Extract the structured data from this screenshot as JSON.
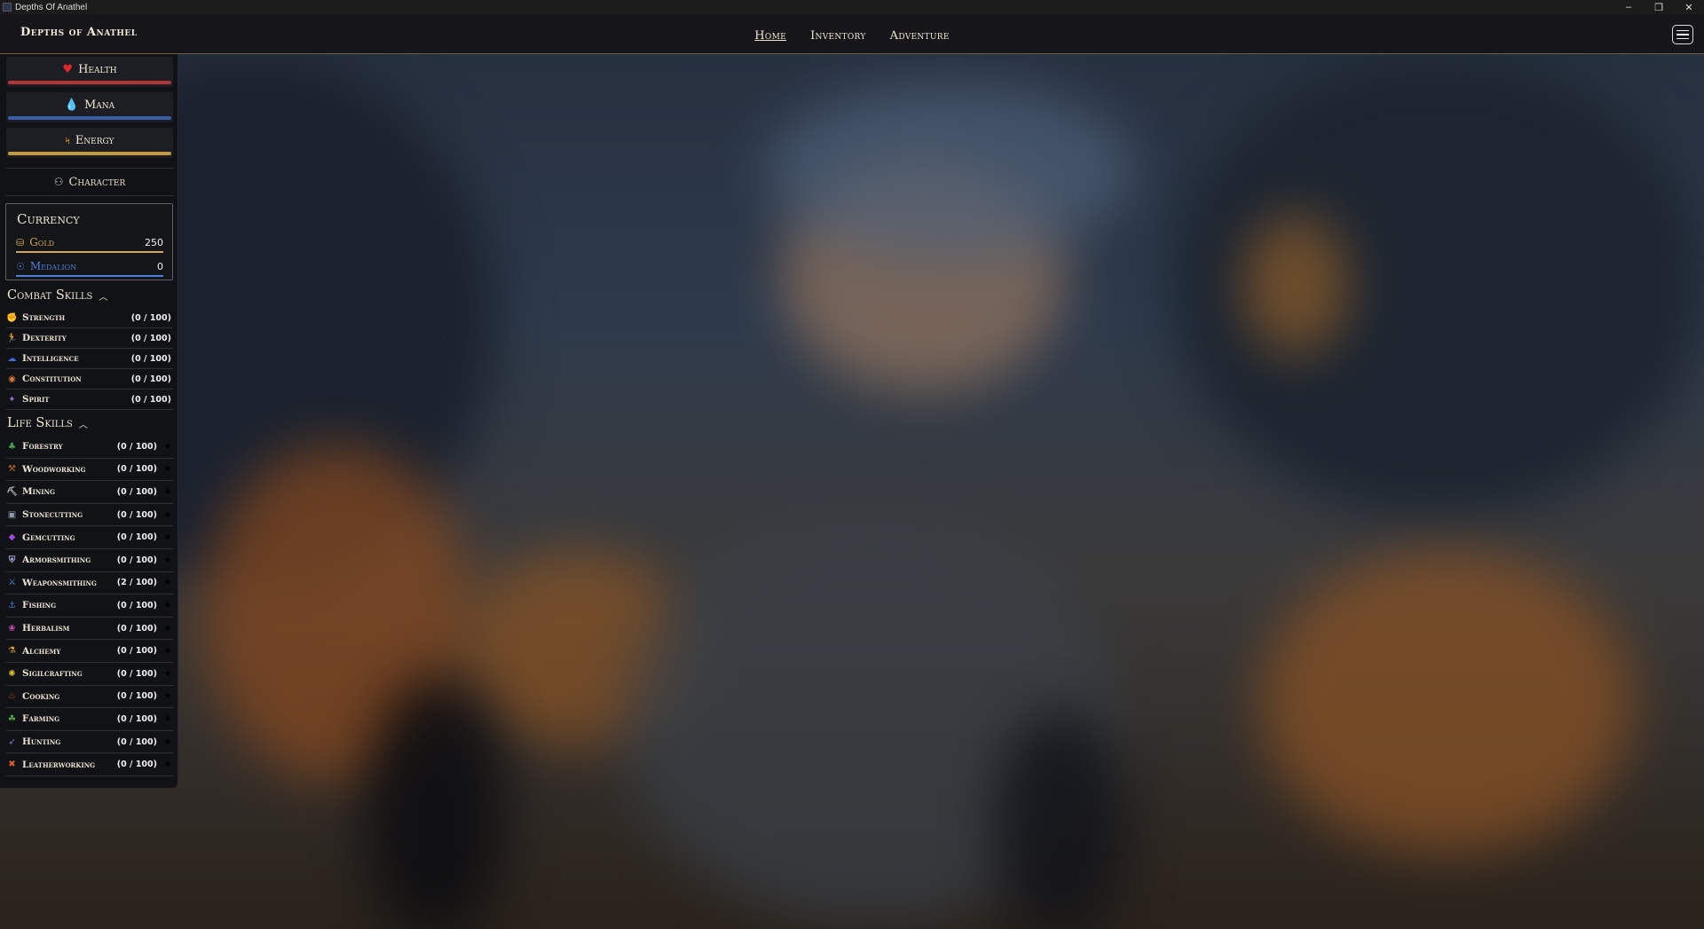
{
  "window": {
    "title": "Depths Of Anathel",
    "controls": [
      "–",
      "❐",
      "✕"
    ]
  },
  "nav": {
    "brand": "Depths of Anathel",
    "links": [
      {
        "label": "Home",
        "active": true
      },
      {
        "label": "Inventory",
        "active": false
      },
      {
        "label": "Adventure",
        "active": false
      }
    ],
    "menu_icon": "hamburger-icon"
  },
  "stats": {
    "health": {
      "label": "Health",
      "icon": "heart-icon",
      "color": "#c0393b"
    },
    "mana": {
      "label": "Mana",
      "icon": "droplet-icon",
      "color": "#3a5fb0"
    },
    "energy": {
      "label": "Energy",
      "icon": "lightning-icon",
      "color": "#c79a3a"
    }
  },
  "character": {
    "label": "Character",
    "icon": "people-icon"
  },
  "currency": {
    "title": "Currency",
    "gold": {
      "label": "Gold",
      "value": "250",
      "color": "#d4a84a"
    },
    "medalion": {
      "label": "Medalion",
      "value": "0",
      "color": "#4f7fd6"
    }
  },
  "combat_skills": {
    "title": "Combat Skills",
    "items": [
      {
        "name": "Strength",
        "value": "(0 / 100)",
        "icon": "fist-icon",
        "color": "#d2433c"
      },
      {
        "name": "Dexterity",
        "value": "(0 / 100)",
        "icon": "running-icon",
        "color": "#3fbf4a"
      },
      {
        "name": "Intelligence",
        "value": "(0 / 100)",
        "icon": "brain-icon",
        "color": "#3d6fd8"
      },
      {
        "name": "Constitution",
        "value": "(0 / 100)",
        "icon": "chest-icon",
        "color": "#d87a3a"
      },
      {
        "name": "Spirit",
        "value": "(0 / 100)",
        "icon": "spirit-icon",
        "color": "#9a6ad8"
      }
    ]
  },
  "life_skills": {
    "title": "Life Skills",
    "items": [
      {
        "name": "Forestry",
        "value": "(0 / 100)",
        "icon": "tree-icon",
        "color": "#3fa54a"
      },
      {
        "name": "Woodworking",
        "value": "(0 / 100)",
        "icon": "saw-icon",
        "color": "#c86a2a"
      },
      {
        "name": "Mining",
        "value": "(0 / 100)",
        "icon": "pickaxe-icon",
        "color": "#bdbdbd"
      },
      {
        "name": "Stonecutting",
        "value": "(0 / 100)",
        "icon": "stone-icon",
        "color": "#8e9bb0"
      },
      {
        "name": "Gemcutting",
        "value": "(0 / 100)",
        "icon": "gem-icon",
        "color": "#a048d8"
      },
      {
        "name": "Armorsmithing",
        "value": "(0 / 100)",
        "icon": "armor-icon",
        "color": "#9aa7c8"
      },
      {
        "name": "Weaponsmithing",
        "value": "(2 / 100)",
        "icon": "swords-icon",
        "color": "#4a8ad8"
      },
      {
        "name": "Fishing",
        "value": "(0 / 100)",
        "icon": "fishing-rod-icon",
        "color": "#3d7fd0"
      },
      {
        "name": "Herbalism",
        "value": "(0 / 100)",
        "icon": "herb-icon",
        "color": "#d04ab8"
      },
      {
        "name": "Alchemy",
        "value": "(0 / 100)",
        "icon": "potion-icon",
        "color": "#e0a020"
      },
      {
        "name": "Sigilcrafting",
        "value": "(0 / 100)",
        "icon": "sigil-icon",
        "color": "#d8c030"
      },
      {
        "name": "Cooking",
        "value": "(0 / 100)",
        "icon": "pot-icon",
        "color": "#d0502a"
      },
      {
        "name": "Farming",
        "value": "(0 / 100)",
        "icon": "plant-icon",
        "color": "#5ab04a"
      },
      {
        "name": "Hunting",
        "value": "(0 / 100)",
        "icon": "bow-icon",
        "color": "#8a6ad0"
      },
      {
        "name": "Leatherworking",
        "value": "(0 / 100)",
        "icon": "hide-icon",
        "color": "#e0602a"
      }
    ]
  }
}
